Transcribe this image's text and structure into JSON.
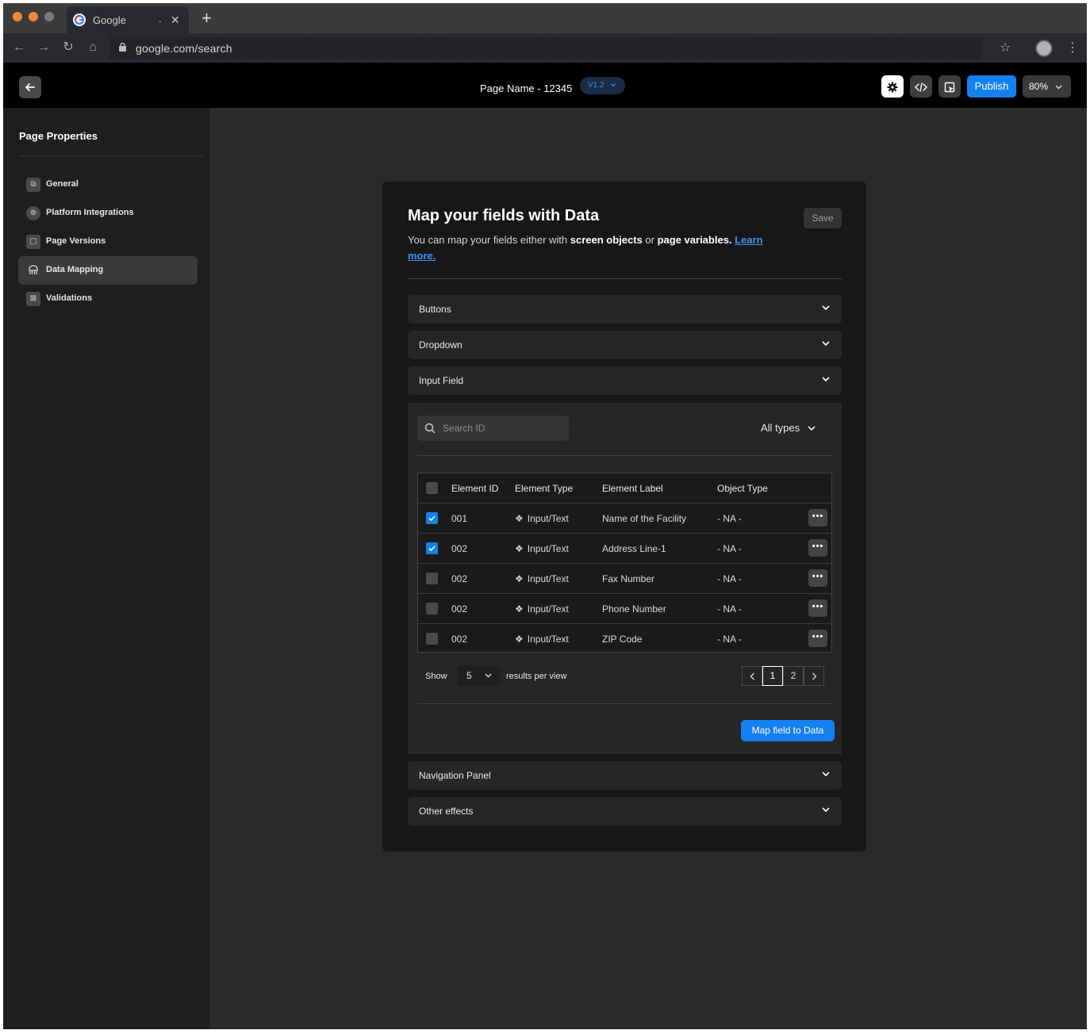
{
  "browser": {
    "tab_title": "Google",
    "tab_extra": ".",
    "url": "google.com/search"
  },
  "header": {
    "page_name": "Page Name - 12345",
    "version": "V1.2",
    "publish_label": "Publish",
    "zoom": "80%"
  },
  "sidebar": {
    "title": "Page Properties",
    "items": [
      {
        "label": "General",
        "icon": "copy-icon"
      },
      {
        "label": "Platform Integrations",
        "icon": "globe-icon"
      },
      {
        "label": "Page Versions",
        "icon": "page-icon"
      },
      {
        "label": "Data Mapping",
        "icon": "data-mapping-icon",
        "active": true
      },
      {
        "label": "Validations",
        "icon": "validation-icon"
      }
    ]
  },
  "card": {
    "title": "Map your fields with Data",
    "desc_prefix": "You can map your fields either with ",
    "desc_bold1": "screen objects",
    "desc_mid": " or ",
    "desc_bold2": "page variables.",
    "desc_link": "Learn more.",
    "save_label": "Save",
    "sections": [
      "Buttons",
      "Dropdown",
      "Input Field",
      "Navigation Panel",
      "Other effects"
    ]
  },
  "input_field": {
    "search_placeholder": "Search ID",
    "type_filter": "All types",
    "columns": [
      "Element ID",
      "Element Type",
      "Element Label",
      "Object Type"
    ],
    "rows": [
      {
        "id": "001",
        "type": "Input/Text",
        "label": "Name of the Facility",
        "object": "- NA -",
        "checked": true
      },
      {
        "id": "002",
        "type": "Input/Text",
        "label": "Address Line-1",
        "object": "- NA -",
        "checked": true
      },
      {
        "id": "002",
        "type": "Input/Text",
        "label": "Fax Number",
        "object": "- NA -",
        "checked": false
      },
      {
        "id": "002",
        "type": "Input/Text",
        "label": "Phone Number",
        "object": "- NA -",
        "checked": false
      },
      {
        "id": "002",
        "type": "Input/Text",
        "label": "ZIP Code",
        "object": "- NA -",
        "checked": false
      }
    ],
    "show_label": "Show",
    "per_page": "5",
    "per_page_label": "results per view",
    "pages": [
      "1",
      "2"
    ],
    "current_page": "1",
    "map_button": "Map field to Data"
  },
  "colors": {
    "accent": "#1380f0",
    "traffic_light": "#f0883b"
  }
}
